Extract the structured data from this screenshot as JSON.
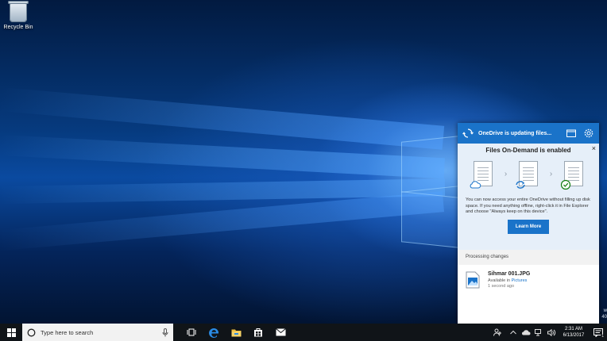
{
  "desktop": {
    "recycle_bin_label": "Recycle Bin",
    "edge_text": [
      "w",
      "40"
    ]
  },
  "onedrive": {
    "status": "OneDrive is updating files...",
    "promo_title": "Files On-Demand is enabled",
    "promo_body": "You can now access your entire OneDrive without filling up disk space. If you need anything offline, right-click it in File Explorer and choose \"Always keep on this device\".",
    "learn_more_label": "Learn More",
    "close_glyph": "×",
    "processing_header": "Processing changes",
    "file": {
      "name": "Sihmar 001.JPG",
      "available_prefix": "Available in ",
      "location": "Pictures",
      "time": "1 second ago"
    },
    "colors": {
      "accent": "#1a73c9",
      "promo_bg": "#e6eff9"
    }
  },
  "taskbar": {
    "search_placeholder": "Type here to search",
    "time": "2:31 AM",
    "date": "6/13/2017",
    "notification_count": "1",
    "icons": [
      "start-icon",
      "cortana-icon",
      "microphone-icon",
      "task-view-icon",
      "edge-icon",
      "file-explorer-icon",
      "store-icon",
      "mail-icon"
    ]
  }
}
